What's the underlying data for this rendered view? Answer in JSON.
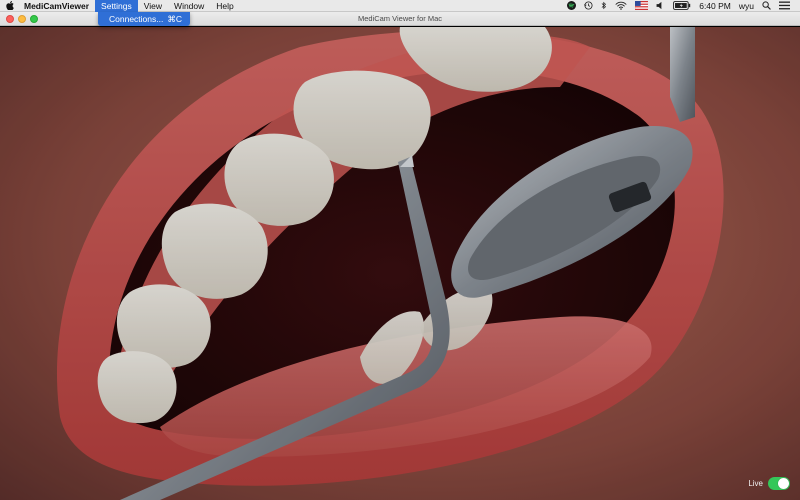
{
  "menubar": {
    "app_name": "MediCamViewer",
    "items": [
      "Settings",
      "View",
      "Window",
      "Help"
    ],
    "active_item": "Settings",
    "clock": "6:40 PM",
    "user": "wyu",
    "icons": [
      "apple-icon",
      "spotify-icon",
      "time-machine-icon",
      "bluetooth-icon",
      "wifi-icon",
      "flag-icon",
      "volume-icon",
      "battery-icon",
      "search-icon",
      "list-icon"
    ]
  },
  "dropdown": {
    "item_label": "Connections...",
    "shortcut": "⌘C"
  },
  "window": {
    "title": "MediCam Viewer for Mac"
  },
  "live": {
    "label": "Live",
    "enabled": true
  },
  "colors": {
    "accent": "#2f6fd6",
    "toggle_on": "#34c759"
  }
}
